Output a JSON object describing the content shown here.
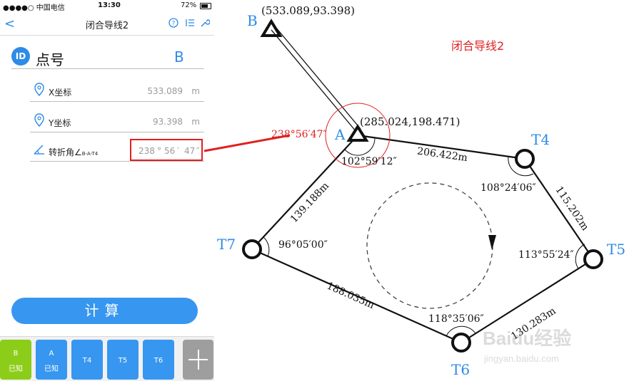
{
  "status": {
    "carrier": "●●●●○ 中国电信",
    "time": "13:30",
    "battery": "72%"
  },
  "nav": {
    "back": "<",
    "title": "闭合导线2",
    "icons": [
      "help-icon",
      "list-sort-icon",
      "wrench-icon"
    ]
  },
  "point": {
    "badge": "ID",
    "label": "点号",
    "value": "B"
  },
  "fields": {
    "x": {
      "icon": "location-pin-icon",
      "label": "X坐标",
      "value": "533.089",
      "unit": "m"
    },
    "y": {
      "icon": "location-pin-icon",
      "label": "Y坐标",
      "value": "93.398",
      "unit": "m"
    },
    "angle": {
      "icon": "angle-icon",
      "label": "转折角∠",
      "sub": "B-A-T4",
      "deg": "238",
      "min": "56",
      "sec": "47",
      "deg_sym": "°",
      "min_sym": "′",
      "sec_sym": "″"
    }
  },
  "calc_button": "计算",
  "tiles": [
    {
      "line1": "B",
      "line2": "已知",
      "color": "#8ccd1a"
    },
    {
      "line1": "A",
      "line2": "已知",
      "color": "#3796f0"
    },
    {
      "line1": "T4",
      "line2": "",
      "color": "#3796f0"
    },
    {
      "line1": "T5",
      "line2": "",
      "color": "#3796f0"
    },
    {
      "line1": "T6",
      "line2": "",
      "color": "#3796f0"
    }
  ],
  "add_tile_icon": "plus-icon",
  "diagram": {
    "title": "闭合导线2",
    "points": {
      "B": "B",
      "A": "A",
      "T4": "T4",
      "T5": "T5",
      "T6": "T6",
      "T7": "T7"
    },
    "coords": {
      "B": "(533.089,93.398)",
      "A": "(285.024,198.471)"
    },
    "distances": {
      "A_T4": "206.422m",
      "T4_T5": "115.202m",
      "T5_T6": "130.283m",
      "T6_T7": "188.035m",
      "T7_A": "139.188m"
    },
    "angles": {
      "A_outer": "238°56′47″",
      "A_inner": "102°59′12″",
      "T4": "108°24′06″",
      "T5": "113°55′24″",
      "T6": "118°35′06″",
      "T7": "96°05′00″"
    },
    "accent_red": "#e02020",
    "label_blue": "#2e8be6"
  },
  "watermark": {
    "brand": "Baidu经验",
    "url": "jingyan.baidu.com"
  }
}
